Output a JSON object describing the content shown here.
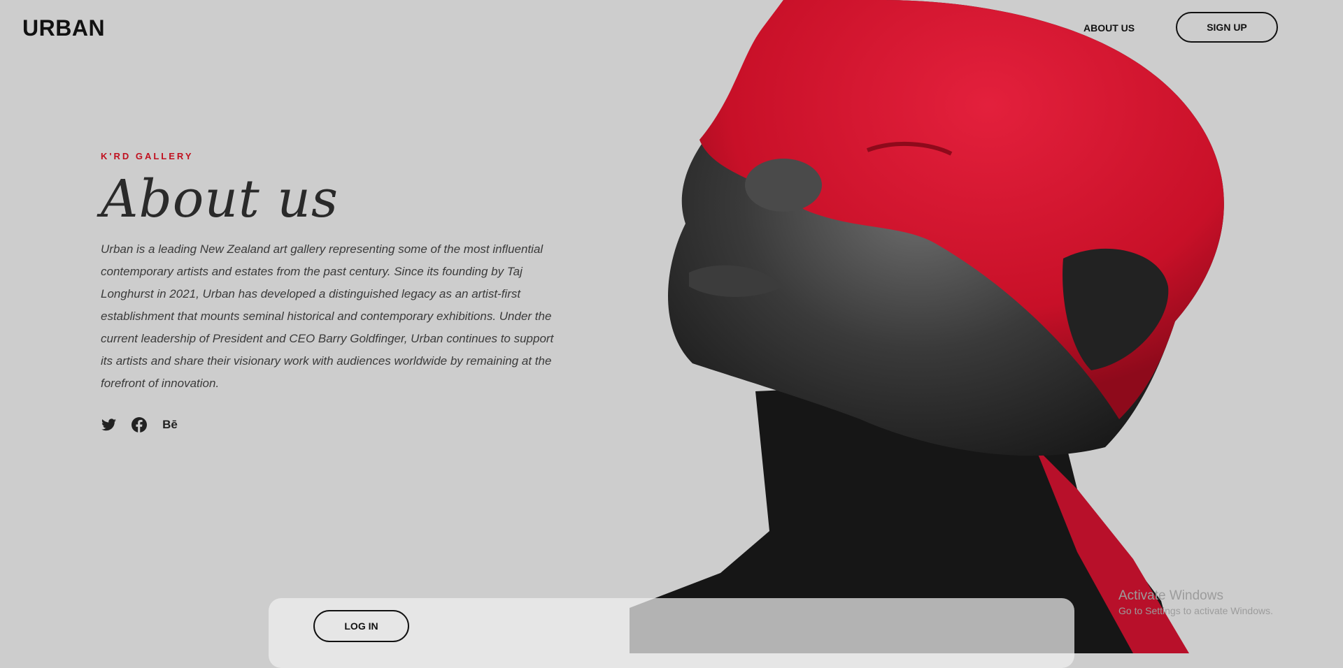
{
  "header": {
    "logo": "URBAN",
    "nav_about": "ABOUT US",
    "signup_label": "SIGN UP"
  },
  "hero": {
    "eyebrow": "K'RD GALLERY",
    "title": "About us",
    "body": "Urban is a leading New Zealand art gallery representing some of the most influential contemporary artists and estates from the past century. Since its founding by Taj Longhurst in 2021, Urban has developed a distinguished legacy as an artist-first establishment that mounts seminal historical and contemporary exhibitions. Under the current leadership of President and CEO Barry Goldfinger, Urban continues to support its artists and share their visionary work with audiences worldwide by remaining at the forefront of innovation.",
    "social": [
      "twitter-icon",
      "facebook-icon",
      "behance-icon"
    ],
    "behance_text": "Bē"
  },
  "footer": {
    "login_label": "LOG IN"
  },
  "watermark": {
    "title": "Activate Windows",
    "subtitle": "Go to Settings to activate Windows."
  },
  "colors": {
    "background": "#cdcdcd",
    "accent_red": "#c0101f",
    "paint_red": "#d8132f"
  }
}
